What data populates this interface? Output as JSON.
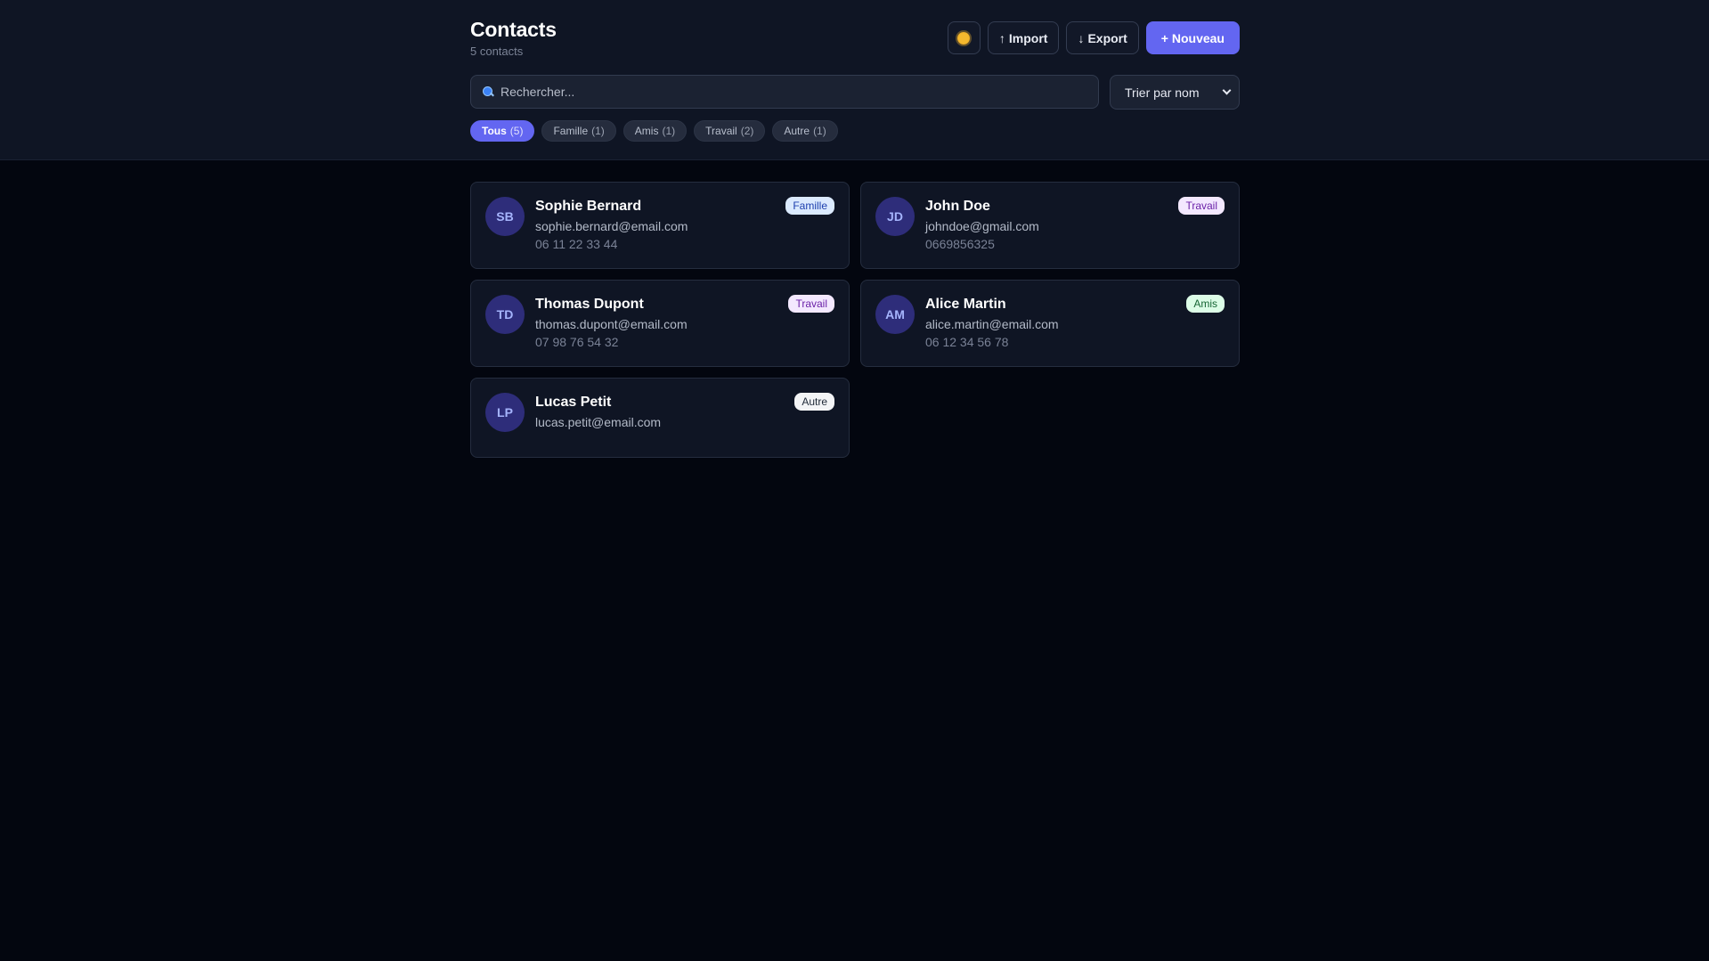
{
  "header": {
    "title": "Contacts",
    "subtitle": "5 contacts",
    "theme_icon": "sun-icon",
    "import_glyph": "↑",
    "import_label": "Import",
    "export_glyph": "↓",
    "export_label": "Export",
    "new_label": "+ Nouveau"
  },
  "search": {
    "placeholder": "Rechercher...",
    "value": ""
  },
  "sort": {
    "selected": "Trier par nom"
  },
  "filters": [
    {
      "label": "Tous",
      "count": "(5)",
      "active": true
    },
    {
      "label": "Famille",
      "count": "(1)",
      "active": false
    },
    {
      "label": "Amis",
      "count": "(1)",
      "active": false
    },
    {
      "label": "Travail",
      "count": "(2)",
      "active": false
    },
    {
      "label": "Autre",
      "count": "(1)",
      "active": false
    }
  ],
  "contacts": [
    {
      "initials": "SB",
      "name": "Sophie Bernard",
      "email": "sophie.bernard@email.com",
      "phone": "06 11 22 33 44",
      "tag": "Famille",
      "tag_bg": "#dbeafe",
      "tag_color": "#1e40af"
    },
    {
      "initials": "JD",
      "name": "John Doe",
      "email": "johndoe@gmail.com",
      "phone": "0669856325",
      "tag": "Travail",
      "tag_bg": "#f3e8ff",
      "tag_color": "#6b21a8"
    },
    {
      "initials": "TD",
      "name": "Thomas Dupont",
      "email": "thomas.dupont@email.com",
      "phone": "07 98 76 54 32",
      "tag": "Travail",
      "tag_bg": "#f3e8ff",
      "tag_color": "#6b21a8"
    },
    {
      "initials": "AM",
      "name": "Alice Martin",
      "email": "alice.martin@email.com",
      "phone": "06 12 34 56 78",
      "tag": "Amis",
      "tag_bg": "#dcfce7",
      "tag_color": "#166534"
    },
    {
      "initials": "LP",
      "name": "Lucas Petit",
      "email": "lucas.petit@email.com",
      "phone": "",
      "tag": "Autre",
      "tag_bg": "#f3f4f6",
      "tag_color": "#1f2937"
    }
  ],
  "colors": {
    "accent": "#6366f1",
    "background": "#03060f",
    "surface": "#0f1524"
  }
}
